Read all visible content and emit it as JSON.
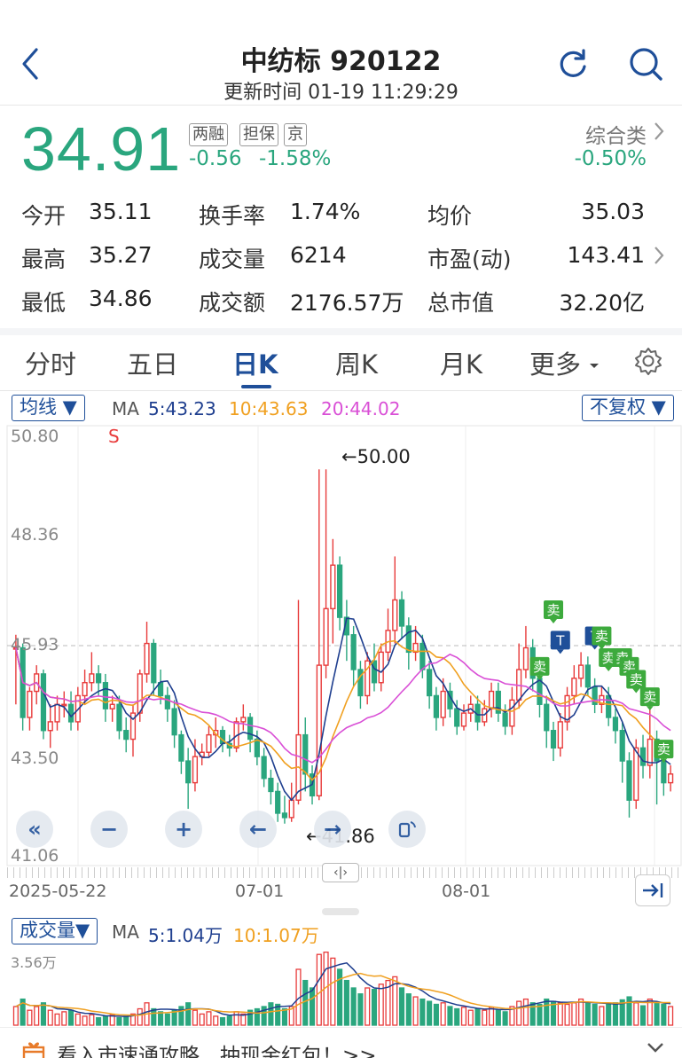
{
  "header": {
    "title": "中纺标 920122",
    "subtitle": "更新时间 01-19 11:29:29"
  },
  "quote": {
    "price": "34.91",
    "tags": [
      "两融",
      "担保",
      "京"
    ],
    "change": "-0.56",
    "change_pct": "-1.58%",
    "category_name": "综合类",
    "category_change": "-0.50%"
  },
  "stats": {
    "open_label": "今开",
    "open_value": "35.11",
    "high_label": "最高",
    "high_value": "35.27",
    "low_label": "最低",
    "low_value": "34.86",
    "turnover_label": "换手率",
    "turnover_value": "1.74%",
    "volume_label": "成交量",
    "volume_value": "6214",
    "amount_label": "成交额",
    "amount_value": "2176.57万",
    "avg_label": "均价",
    "avg_value": "35.03",
    "pe_label": "市盈(动)",
    "pe_value": "143.41",
    "mktcap_label": "总市值",
    "mktcap_value": "32.20亿"
  },
  "tabs": [
    "分时",
    "五日",
    "日K",
    "周K",
    "月K",
    "更多"
  ],
  "active_tab": "日K",
  "kline": {
    "ma_selector": "均线",
    "ma_label": "MA",
    "ma5": "5:43.23",
    "ma10": "10:43.63",
    "ma20": "20:44.02",
    "adjust_selector": "不复权",
    "y_ticks": [
      "50.80",
      "48.36",
      "45.93",
      "43.50",
      "41.06"
    ],
    "s_marker": "S",
    "high_annotation": "←50.00",
    "low_annotation": "←41.86",
    "x_labels": [
      "2025-05-22",
      "07-01",
      "08-01"
    ],
    "sell_marker": "卖",
    "t_marker": "T",
    "pan_label": "‹|›"
  },
  "volume": {
    "selector": "成交量",
    "ma_label": "MA",
    "ma5": "5:1.04万",
    "ma10": "10:1.07万",
    "y_max": "3.56万"
  },
  "banner": {
    "text": "看入市速通攻略，抽现金红包！>>"
  },
  "colors": {
    "up": "#e83b3b",
    "down": "#2aa67e",
    "ma5": "#1f3f8f",
    "ma10": "#f0a020",
    "ma20": "#d94fd6",
    "accent": "#1f4f99"
  },
  "chart_data": {
    "type": "candlestick",
    "y_range": [
      41.06,
      50.8
    ],
    "candles": [
      [
        45.9,
        45.9,
        46.2,
        44.6
      ],
      [
        45.9,
        44.3,
        46.0,
        44.0
      ],
      [
        44.3,
        44.9,
        45.0,
        44.0
      ],
      [
        44.9,
        45.3,
        45.5,
        44.6
      ],
      [
        45.3,
        44.0,
        45.4,
        43.8
      ],
      [
        44.0,
        44.2,
        44.6,
        43.6
      ],
      [
        44.2,
        44.6,
        44.8,
        44.0
      ],
      [
        44.6,
        44.6,
        44.9,
        44.3
      ],
      [
        44.6,
        44.2,
        44.9,
        44.0
      ],
      [
        44.2,
        44.8,
        45.0,
        44.0
      ],
      [
        44.8,
        45.1,
        45.4,
        44.6
      ],
      [
        45.1,
        45.3,
        45.8,
        44.9
      ],
      [
        45.3,
        45.1,
        45.5,
        44.8
      ],
      [
        45.1,
        44.5,
        45.3,
        44.2
      ],
      [
        44.5,
        44.6,
        44.8,
        44.2
      ],
      [
        44.6,
        44.0,
        44.8,
        43.8
      ],
      [
        44.0,
        43.8,
        44.3,
        43.5
      ],
      [
        43.8,
        44.4,
        44.6,
        43.4
      ],
      [
        44.4,
        45.3,
        45.4,
        44.2
      ],
      [
        45.3,
        46.0,
        46.5,
        45.1
      ],
      [
        46.0,
        45.1,
        46.1,
        44.8
      ],
      [
        45.1,
        44.8,
        45.4,
        44.6
      ],
      [
        44.8,
        44.5,
        45.0,
        44.2
      ],
      [
        44.5,
        43.9,
        44.7,
        43.6
      ],
      [
        43.9,
        43.3,
        44.0,
        43.0
      ],
      [
        43.3,
        42.8,
        43.6,
        42.2
      ],
      [
        42.8,
        43.4,
        43.8,
        42.6
      ],
      [
        43.4,
        43.5,
        43.7,
        43.2
      ],
      [
        43.5,
        43.9,
        44.1,
        43.4
      ],
      [
        43.9,
        44.0,
        44.3,
        43.6
      ],
      [
        44.0,
        43.7,
        44.1,
        43.5
      ],
      [
        43.7,
        43.6,
        43.9,
        43.4
      ],
      [
        43.6,
        44.2,
        44.3,
        43.5
      ],
      [
        44.2,
        44.3,
        44.6,
        44.0
      ],
      [
        44.3,
        43.8,
        44.4,
        43.5
      ],
      [
        43.8,
        43.4,
        44.0,
        43.2
      ],
      [
        43.4,
        42.9,
        43.6,
        42.7
      ],
      [
        42.9,
        42.6,
        43.1,
        42.3
      ],
      [
        42.6,
        42.1,
        42.8,
        41.9
      ],
      [
        42.1,
        42.0,
        42.5,
        41.86
      ],
      [
        42.0,
        42.4,
        42.8,
        41.9
      ],
      [
        42.4,
        43.9,
        47.0,
        42.3
      ],
      [
        43.9,
        43.0,
        44.3,
        42.6
      ],
      [
        43.0,
        42.5,
        43.2,
        42.3
      ],
      [
        42.5,
        45.5,
        50.0,
        42.4
      ],
      [
        45.5,
        46.8,
        50.0,
        45.2
      ],
      [
        46.8,
        47.8,
        48.4,
        46.0
      ],
      [
        47.8,
        46.6,
        48.0,
        46.3
      ],
      [
        46.6,
        46.2,
        47.0,
        45.6
      ],
      [
        46.2,
        45.4,
        46.4,
        45.0
      ],
      [
        45.4,
        44.8,
        45.6,
        44.5
      ],
      [
        44.8,
        45.6,
        45.8,
        44.6
      ],
      [
        45.6,
        45.1,
        46.0,
        44.9
      ],
      [
        45.1,
        45.8,
        46.0,
        44.9
      ],
      [
        45.8,
        46.3,
        46.8,
        45.6
      ],
      [
        46.3,
        47.0,
        48.0,
        46.0
      ],
      [
        47.0,
        46.4,
        47.2,
        46.1
      ],
      [
        46.4,
        45.8,
        46.6,
        45.4
      ],
      [
        45.8,
        46.0,
        46.4,
        45.6
      ],
      [
        46.0,
        45.4,
        46.2,
        45.2
      ],
      [
        45.4,
        44.8,
        45.6,
        44.5
      ],
      [
        44.8,
        44.3,
        45.0,
        44.0
      ],
      [
        44.3,
        44.9,
        45.2,
        44.1
      ],
      [
        44.9,
        44.5,
        45.1,
        44.3
      ],
      [
        44.5,
        44.1,
        44.7,
        43.9
      ],
      [
        44.1,
        44.4,
        44.6,
        44.0
      ],
      [
        44.4,
        44.6,
        44.8,
        44.2
      ],
      [
        44.6,
        44.2,
        44.8,
        44.0
      ],
      [
        44.2,
        44.5,
        44.7,
        44.1
      ],
      [
        44.5,
        44.9,
        45.1,
        44.3
      ],
      [
        44.9,
        44.4,
        45.1,
        44.2
      ],
      [
        44.4,
        44.1,
        44.6,
        43.9
      ],
      [
        44.1,
        44.7,
        45.0,
        43.9
      ],
      [
        44.7,
        45.4,
        46.0,
        44.5
      ],
      [
        45.4,
        45.9,
        46.4,
        45.2
      ],
      [
        45.9,
        45.2,
        46.1,
        44.9
      ],
      [
        45.2,
        44.6,
        45.4,
        44.3
      ],
      [
        44.6,
        44.0,
        44.8,
        43.6
      ],
      [
        44.0,
        43.6,
        44.2,
        43.3
      ],
      [
        43.6,
        44.2,
        44.4,
        43.4
      ],
      [
        44.2,
        44.8,
        45.0,
        44.0
      ],
      [
        44.8,
        45.2,
        45.5,
        44.6
      ],
      [
        45.2,
        45.5,
        45.8,
        45.0
      ],
      [
        45.5,
        45.0,
        45.7,
        44.8
      ],
      [
        45.0,
        44.6,
        45.2,
        44.4
      ],
      [
        44.6,
        44.8,
        45.0,
        44.4
      ],
      [
        44.8,
        44.3,
        45.0,
        44.1
      ],
      [
        44.3,
        44.0,
        44.5,
        43.7
      ],
      [
        44.0,
        43.3,
        44.2,
        42.8
      ],
      [
        43.3,
        42.4,
        43.5,
        42.0
      ],
      [
        42.4,
        43.6,
        43.8,
        42.2
      ],
      [
        43.6,
        43.2,
        43.9,
        42.9
      ],
      [
        43.2,
        43.8,
        44.8,
        42.9
      ],
      [
        43.8,
        43.3,
        44.0,
        42.3
      ],
      [
        43.3,
        42.8,
        43.5,
        42.5
      ],
      [
        42.8,
        43.0,
        43.2,
        42.6
      ]
    ],
    "volumes_relative": [
      0.25,
      0.35,
      0.2,
      0.25,
      0.3,
      0.2,
      0.15,
      0.18,
      0.2,
      0.15,
      0.12,
      0.14,
      0.1,
      0.12,
      0.14,
      0.1,
      0.12,
      0.15,
      0.22,
      0.3,
      0.22,
      0.18,
      0.15,
      0.2,
      0.25,
      0.3,
      0.2,
      0.15,
      0.18,
      0.12,
      0.1,
      0.12,
      0.18,
      0.15,
      0.2,
      0.22,
      0.25,
      0.3,
      0.28,
      0.22,
      0.25,
      0.75,
      0.6,
      0.5,
      0.95,
      0.98,
      0.9,
      0.75,
      0.6,
      0.5,
      0.42,
      0.5,
      0.48,
      0.55,
      0.6,
      0.65,
      0.5,
      0.42,
      0.38,
      0.35,
      0.32,
      0.28,
      0.3,
      0.25,
      0.22,
      0.24,
      0.2,
      0.22,
      0.2,
      0.24,
      0.2,
      0.18,
      0.25,
      0.32,
      0.35,
      0.3,
      0.28,
      0.35,
      0.32,
      0.3,
      0.28,
      0.3,
      0.35,
      0.3,
      0.28,
      0.25,
      0.28,
      0.3,
      0.34,
      0.38,
      0.3,
      0.26,
      0.35,
      0.3,
      0.28,
      0.25
    ]
  }
}
